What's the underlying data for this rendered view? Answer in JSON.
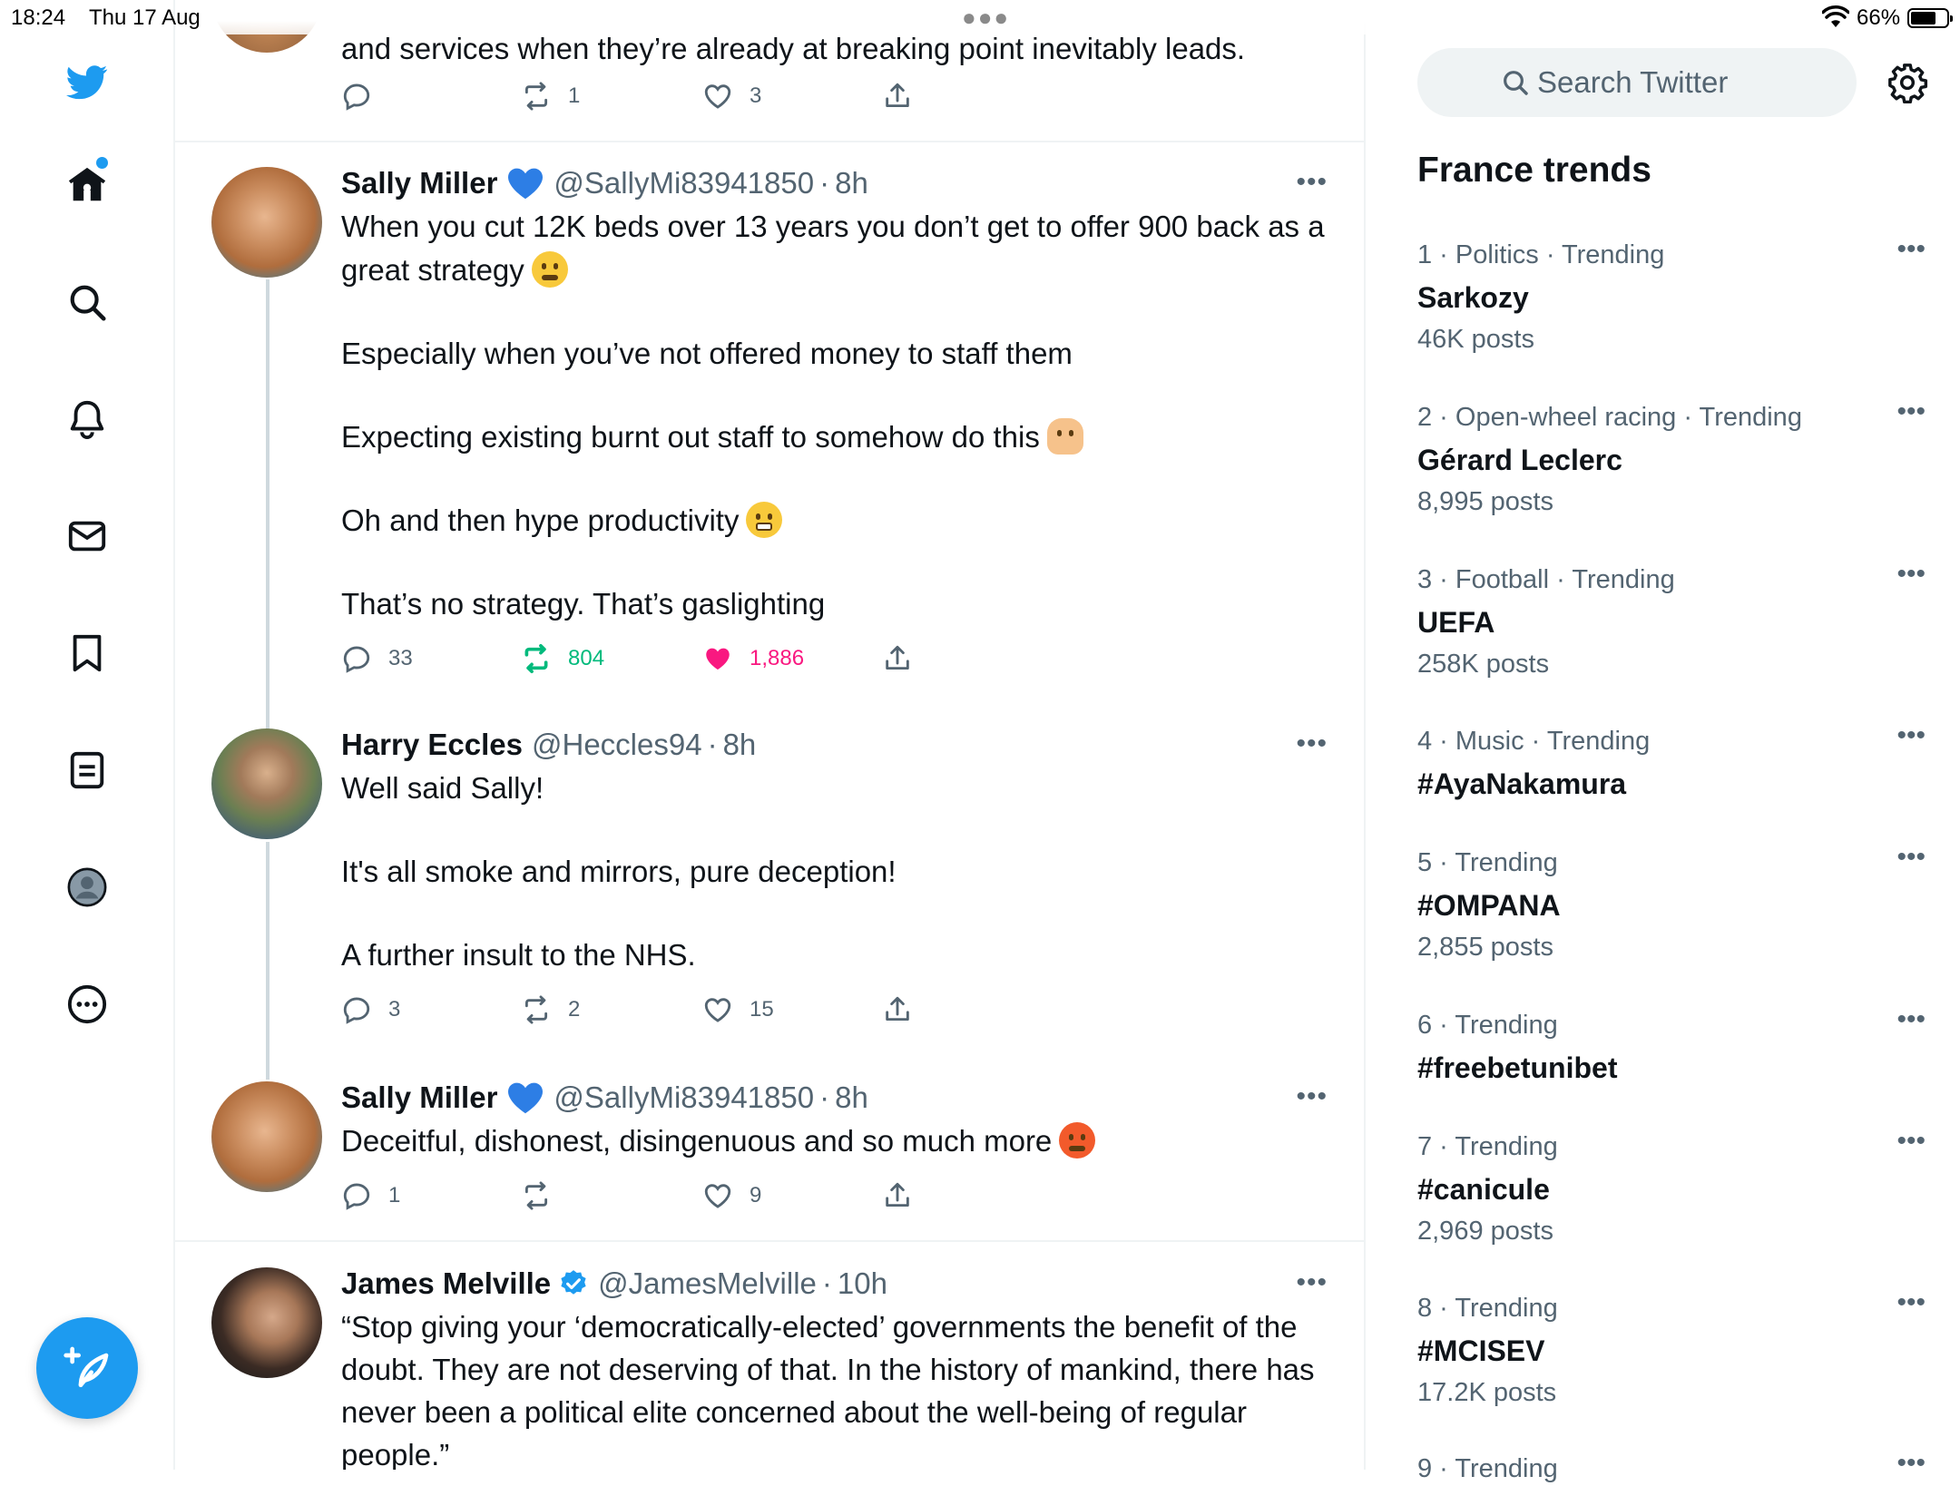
{
  "status_bar": {
    "time": "18:24",
    "date": "Thu 17 Aug",
    "battery": "66%",
    "battery_level": 0.66
  },
  "colors": {
    "accent": "#1d9bf0",
    "retweet_active": "#00ba7c",
    "like_active": "#f91880",
    "secondary_text": "#536471",
    "divider": "#eff3f4"
  },
  "nav": {
    "items": [
      "twitter-logo",
      "home-icon",
      "search-icon",
      "notifications-icon",
      "messages-icon",
      "bookmarks-icon",
      "lists-icon",
      "profile-icon",
      "more-icon"
    ],
    "compose_icon": "compose-feather-icon"
  },
  "timeline": {
    "partial_tweet": {
      "text": "and services when they’re already at breaking point inevitably leads.",
      "replies": "",
      "retweets": "1",
      "likes": "3"
    },
    "tweets": [
      {
        "name": "Sally Miller",
        "badge": "blue-heart-emoji",
        "handle": "@SallyMi83941850",
        "time": "8h",
        "paragraphs": [
          "When you cut 12K beds over 13 years you don’t get to offer 900 back as a great strategy",
          "Especially when you’ve not offered money to staff them",
          "Expecting  existing burnt out staff to somehow do this",
          "Oh and then hype productivity",
          "That’s no strategy. That’s gaslighting"
        ],
        "replies": "33",
        "retweets": "804",
        "likes": "1,886",
        "retweeted": true,
        "liked": true
      },
      {
        "name": "Harry Eccles",
        "handle": "@Heccles94",
        "time": "8h",
        "paragraphs": [
          "Well said Sally!",
          "It's all smoke and mirrors, pure deception!",
          "A further insult to the NHS."
        ],
        "replies": "3",
        "retweets": "2",
        "likes": "15"
      },
      {
        "name": "Sally Miller",
        "badge": "blue-heart-emoji",
        "handle": "@SallyMi83941850",
        "time": "8h",
        "paragraphs": [
          "Deceitful, dishonest, disingenuous and so much more"
        ],
        "replies": "1",
        "retweets": "",
        "likes": "9"
      },
      {
        "name": "James Melville",
        "badge": "verified-icon",
        "handle": "@JamesMelville",
        "time": "10h",
        "paragraphs": [
          "“Stop giving your ‘democratically-elected’ governments the benefit of the doubt. They are not deserving of that. In the history of mankind, there has never been a political elite concerned about the well-being of regular people.”"
        ]
      }
    ]
  },
  "sidebar": {
    "search_placeholder": "Search Twitter",
    "trends_title": "France trends",
    "trends": [
      {
        "meta": "1 · Politics · Trending",
        "topic": "Sarkozy",
        "count": "46K posts"
      },
      {
        "meta": "2 · Open-wheel racing · Trending",
        "topic": "Gérard Leclerc",
        "count": "8,995 posts"
      },
      {
        "meta": "3 · Football · Trending",
        "topic": "UEFA",
        "count": "258K posts"
      },
      {
        "meta": "4 · Music · Trending",
        "topic": "#AyaNakamura",
        "count": ""
      },
      {
        "meta": "5 · Trending",
        "topic": "#OMPANA",
        "count": "2,855 posts"
      },
      {
        "meta": "6 · Trending",
        "topic": "#freebetunibet",
        "count": ""
      },
      {
        "meta": "7 · Trending",
        "topic": "#canicule",
        "count": "2,969 posts"
      },
      {
        "meta": "8 · Trending",
        "topic": "#MCISEV",
        "count": "17.2K posts"
      },
      {
        "meta": "9 · Trending",
        "topic": "",
        "count": ""
      }
    ]
  }
}
